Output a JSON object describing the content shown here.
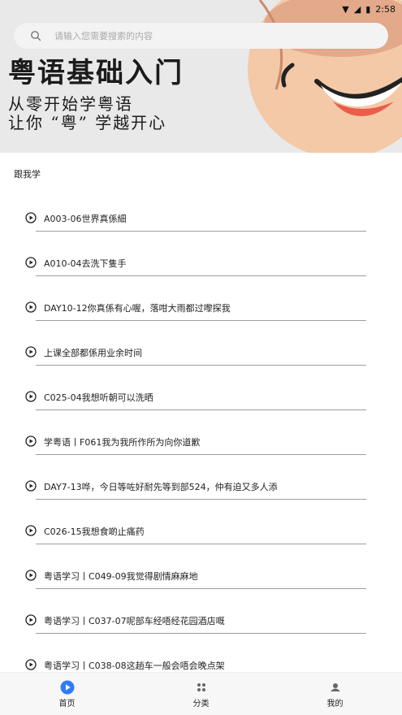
{
  "status_bar": {
    "time": "2:58"
  },
  "banner": {
    "title": "粤语基础入门",
    "subtitle_line1": "从零开始学粤语",
    "subtitle_line2": "让你 “粤” 学越开心"
  },
  "search": {
    "placeholder": "请输入您需要搜索的内容"
  },
  "section": {
    "title": "跟我学"
  },
  "items": [
    {
      "title": "A003-06世界真係細"
    },
    {
      "title": "A010-04去洗下隻手"
    },
    {
      "title": "DAY10-12你真係有心喔，落咁大雨都过嚟探我"
    },
    {
      "title": "上课全部都係用业余时间"
    },
    {
      "title": "C025-04我想听朝可以洗晒"
    },
    {
      "title": "学粤语丨F061我为我所作所为向你道歉"
    },
    {
      "title": "DAY7-13哗，今日等咗好耐先等到部524，仲有迫又多人添"
    },
    {
      "title": "C026-15我想食啲止痛药"
    },
    {
      "title": "粤语学习丨C049-09我觉得剧情麻麻地"
    },
    {
      "title": "粤语学习丨C037-07呢部车经唔经花园酒店嘅"
    },
    {
      "title": "粤语学习丨C038-08这趟车一般会唔会晚点架"
    }
  ],
  "nav": {
    "home": "首页",
    "category": "分类",
    "mine": "我的"
  },
  "colors": {
    "accent": "#2f7cf6"
  }
}
